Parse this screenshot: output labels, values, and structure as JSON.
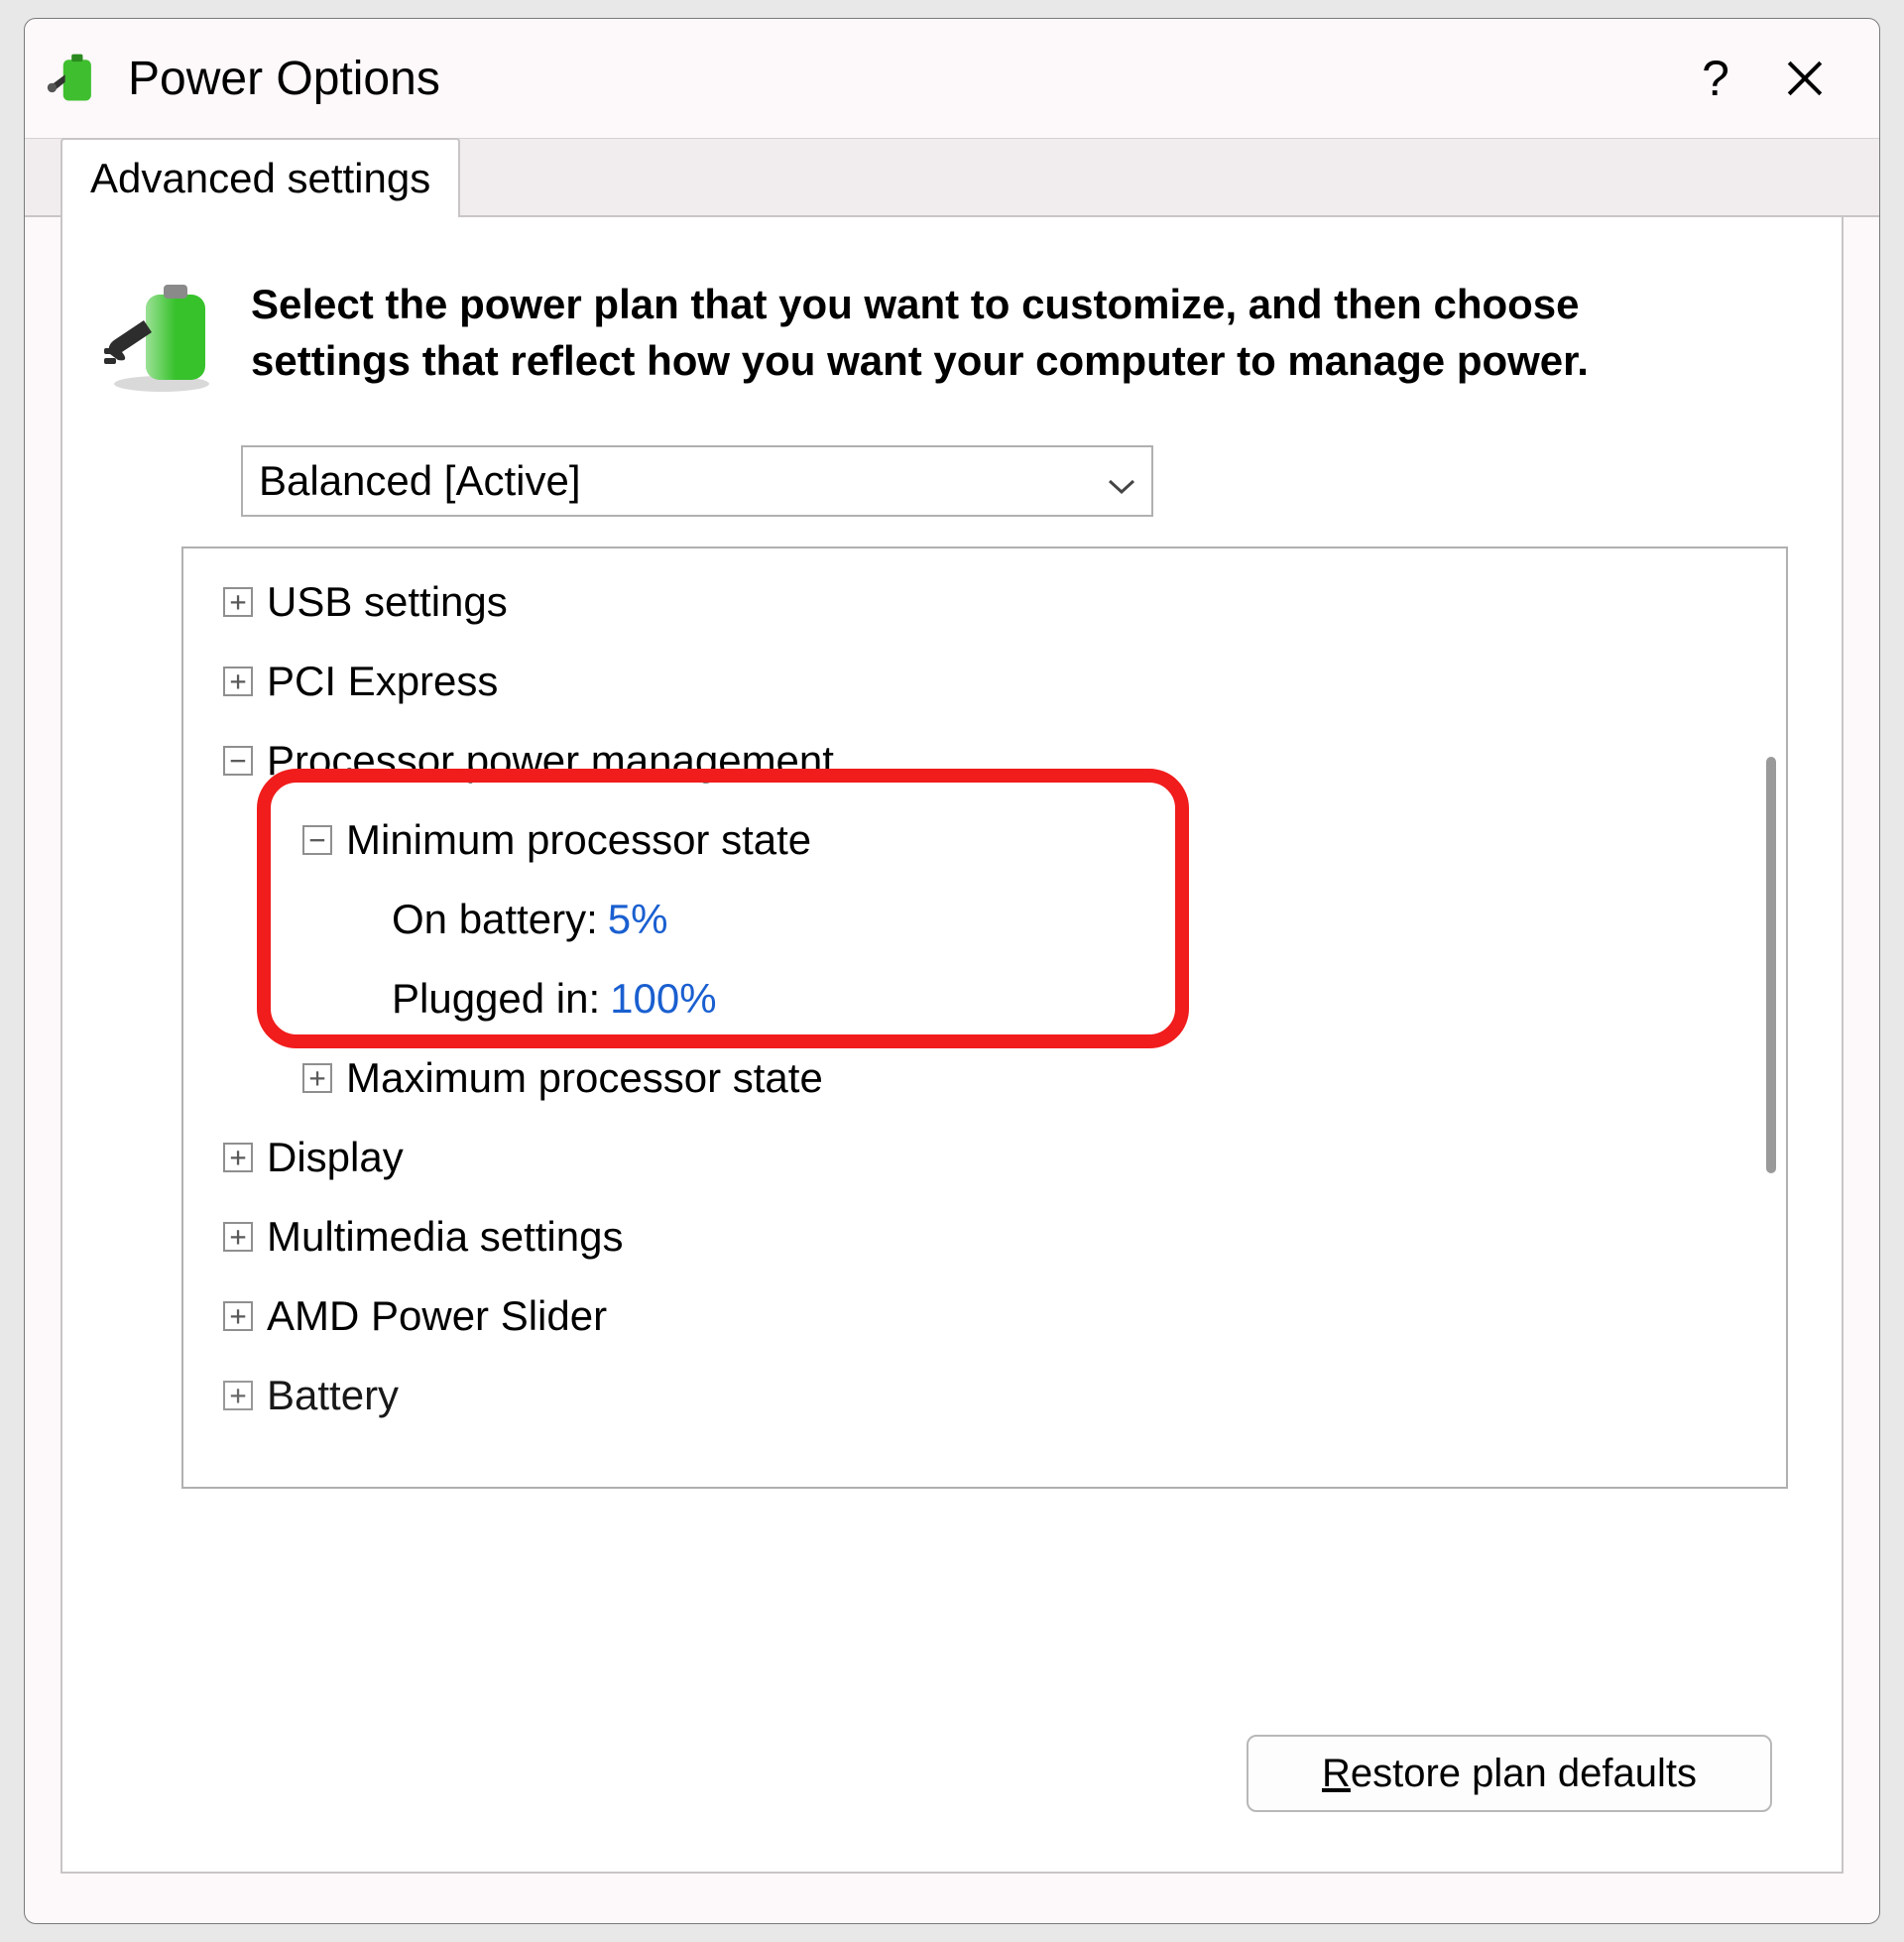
{
  "title": "Power Options",
  "tabs": {
    "advanced": "Advanced settings"
  },
  "intro": "Select the power plan that you want to customize, and then choose settings that reflect how you want your computer to manage power.",
  "plan_selected": "Balanced [Active]",
  "tree": {
    "usb": "USB settings",
    "pci": "PCI Express",
    "ppm": "Processor power management",
    "min_ps": "Minimum processor state",
    "on_battery_label": "On battery:",
    "on_battery_value": "5%",
    "plugged_in_label": "Plugged in:",
    "plugged_in_value": "100%",
    "max_ps": "Maximum processor state",
    "display": "Display",
    "multimedia": "Multimedia settings",
    "amd": "AMD Power Slider",
    "battery": "Battery"
  },
  "restore_button": "Restore plan defaults",
  "restore_button_prefix": "R",
  "restore_button_rest": "estore plan defaults"
}
